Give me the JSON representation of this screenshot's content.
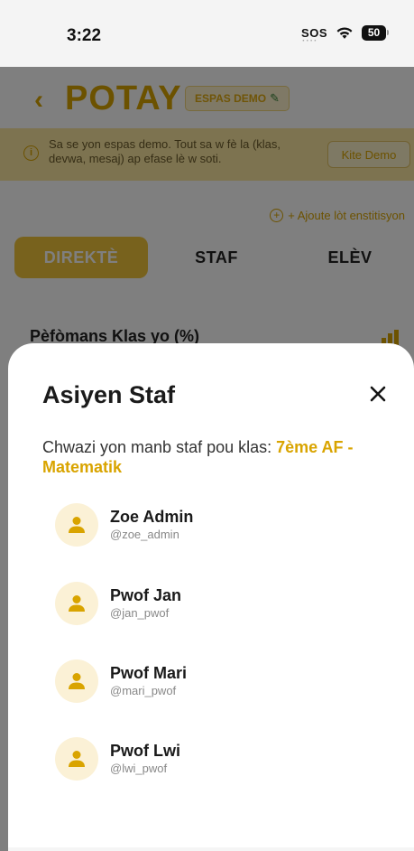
{
  "status_bar": {
    "time": "3:22",
    "sos": "SOS",
    "battery": "50",
    "wifi_icon": "wifi-icon"
  },
  "app": {
    "title": "POTAY",
    "demo_badge": "ESPAS DEMO",
    "demo_banner_text": "Sa se yon espas demo. Tout sa w fè la (klas, devwa, mesaj) ap efase lè w soti.",
    "exit_demo_label": "Kite Demo",
    "add_institution_label": "+ Ajoute lòt enstitisyon",
    "tabs": [
      {
        "label": "DIREKTÈ",
        "active": true
      },
      {
        "label": "STAF",
        "active": false
      },
      {
        "label": "ELÈV",
        "active": false
      }
    ],
    "section_heading": "Pèfòmans Klas yo (%)",
    "accent_color": "#d9a400"
  },
  "modal": {
    "title": "Asiyen Staf",
    "description_prefix": "Chwazi yon manb staf pou klas: ",
    "class_name": "7ème AF - Matematik",
    "close_icon": "close-icon",
    "staff": [
      {
        "name": "Zoe Admin",
        "handle": "@zoe_admin"
      },
      {
        "name": "Pwof Jan",
        "handle": "@jan_pwof"
      },
      {
        "name": "Pwof Mari",
        "handle": "@mari_pwof"
      },
      {
        "name": "Pwof Lwi",
        "handle": "@lwi_pwof"
      }
    ]
  }
}
